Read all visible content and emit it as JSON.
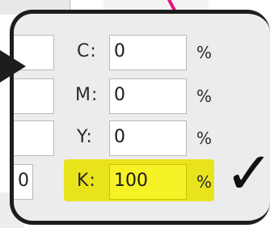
{
  "cmyk_panel": {
    "rows": [
      {
        "label": "C:",
        "value": "0",
        "unit": "%"
      },
      {
        "label": "M:",
        "value": "0",
        "unit": "%"
      },
      {
        "label": "Y:",
        "value": "0",
        "unit": "%"
      },
      {
        "label": "K:",
        "value": "100",
        "unit": "%"
      }
    ],
    "left_fields": [
      "",
      "",
      "",
      "0"
    ],
    "highlight_color": "#e9e31c"
  },
  "annotations": {
    "checkmark": "✓"
  }
}
